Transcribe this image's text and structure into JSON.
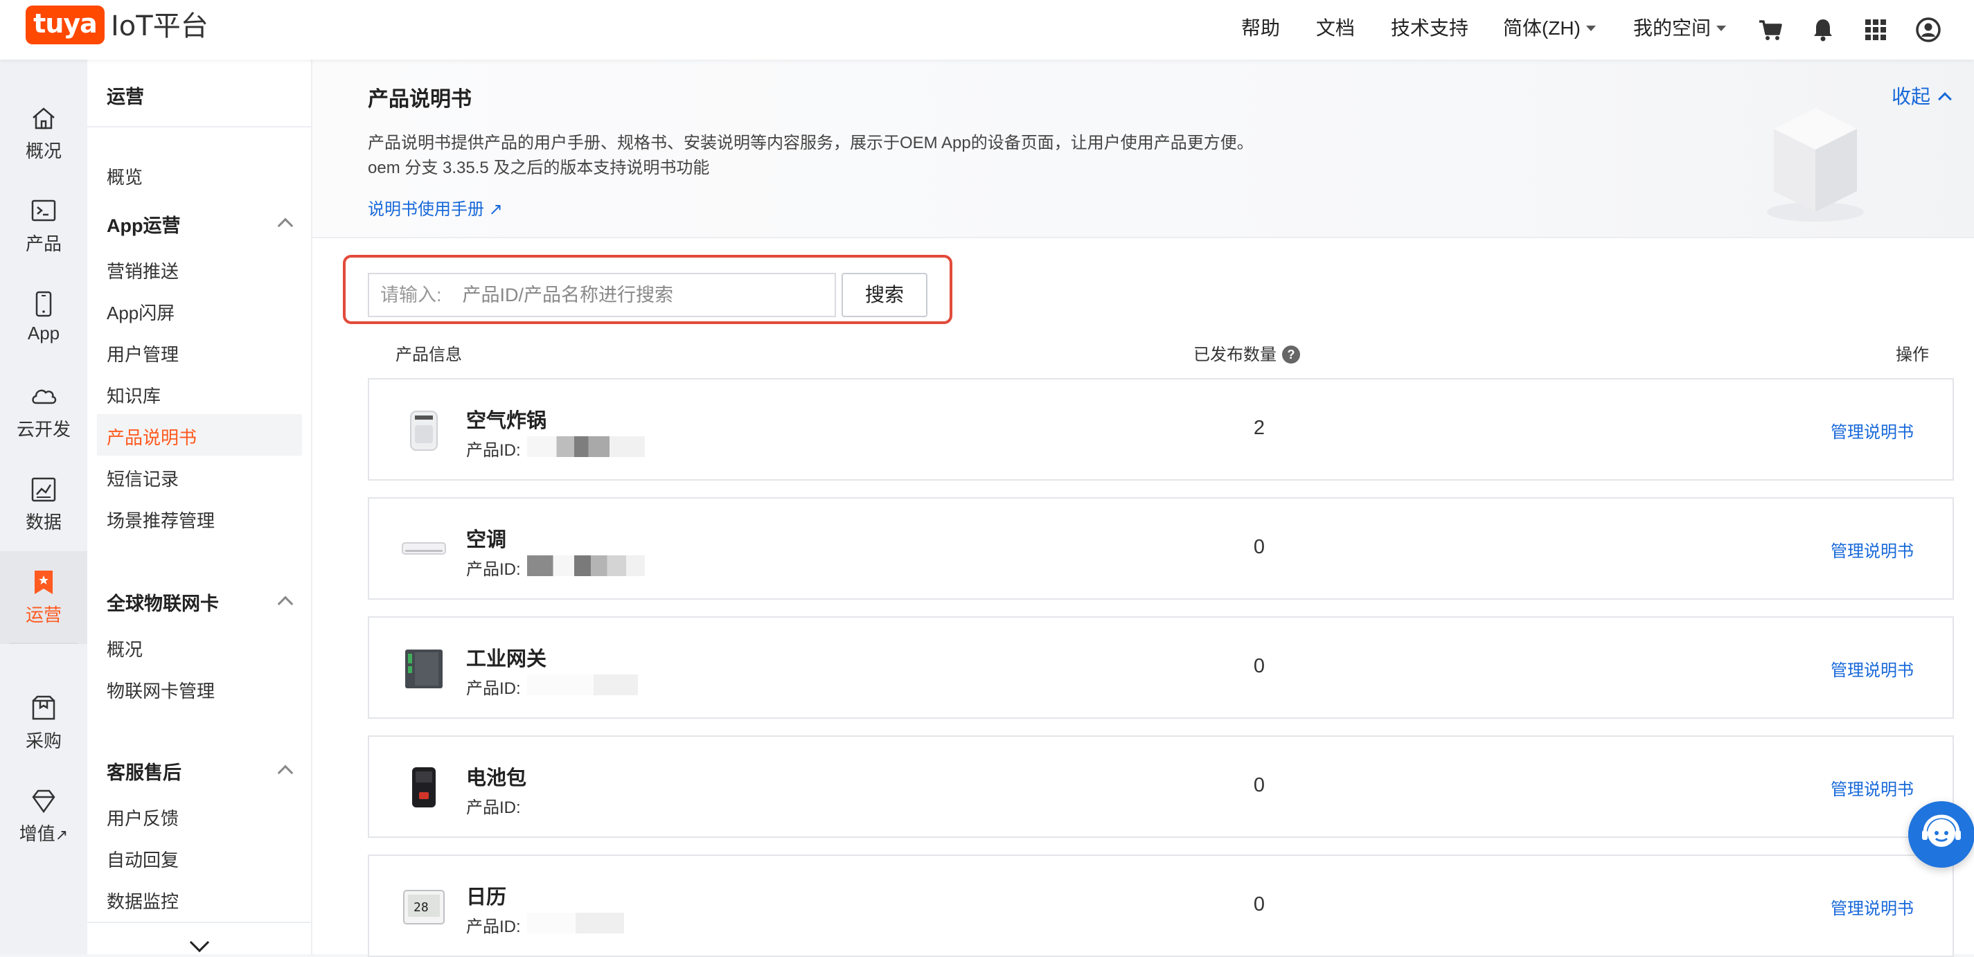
{
  "header": {
    "logo": "tuya",
    "platform": "IoT平台",
    "nav": [
      "帮助",
      "文档",
      "技术支持"
    ],
    "language": "简体(ZH)",
    "space": "我的空间",
    "icons": [
      "cart-icon",
      "bell-icon",
      "apps-grid-icon",
      "user-account-icon"
    ]
  },
  "rail": {
    "items": [
      {
        "label": "概况",
        "icon": "home-icon"
      },
      {
        "label": "产品",
        "icon": "terminal-icon"
      },
      {
        "label": "App",
        "icon": "phone-icon"
      },
      {
        "label": "云开发",
        "icon": "cloud-icon"
      },
      {
        "label": "数据",
        "icon": "chart-icon"
      },
      {
        "label": "运营",
        "icon": "bookmark-star-icon"
      },
      {
        "label": "采购",
        "icon": "box-icon"
      },
      {
        "label": "增值",
        "icon": "diamond-icon"
      }
    ],
    "active": "运营"
  },
  "sidebar": {
    "title": "运营",
    "overview": "概览",
    "groups": [
      {
        "label": "App运营",
        "items": [
          "营销推送",
          "App闪屏",
          "用户管理",
          "知识库",
          "产品说明书",
          "短信记录",
          "场景推荐管理"
        ]
      },
      {
        "label": "全球物联网卡",
        "items": [
          "概况",
          "物联网卡管理"
        ]
      },
      {
        "label": "客服售后",
        "items": [
          "用户反馈",
          "自动回复",
          "数据监控"
        ]
      }
    ],
    "active_item": "产品说明书"
  },
  "main": {
    "title": "产品说明书",
    "desc_line1": "产品说明书提供产品的用户手册、规格书、安装说明等内容服务，展示于OEM App的设备页面，让用户使用产品更方便。",
    "desc_line2": "oem 分支 3.35.5 及之后的版本支持说明书功能",
    "guide_link": "说明书使用手册",
    "collapse_label": "收起",
    "search": {
      "prefix": "请输入:",
      "placeholder": "产品ID/产品名称进行搜索",
      "button": "搜索"
    },
    "table": {
      "headers": {
        "info": "产品信息",
        "published": "已发布数量",
        "action": "操作"
      },
      "id_label": "产品ID:",
      "action_label": "管理说明书",
      "rows": [
        {
          "name": "空气炸锅",
          "count": "2",
          "thumb": "air-fryer"
        },
        {
          "name": "空调",
          "count": "0",
          "thumb": "air-conditioner"
        },
        {
          "name": "工业网关",
          "count": "0",
          "thumb": "gateway"
        },
        {
          "name": "电池包",
          "count": "0",
          "thumb": "battery-pack"
        },
        {
          "name": "日历",
          "count": "0",
          "thumb": "calendar-display"
        }
      ]
    }
  }
}
